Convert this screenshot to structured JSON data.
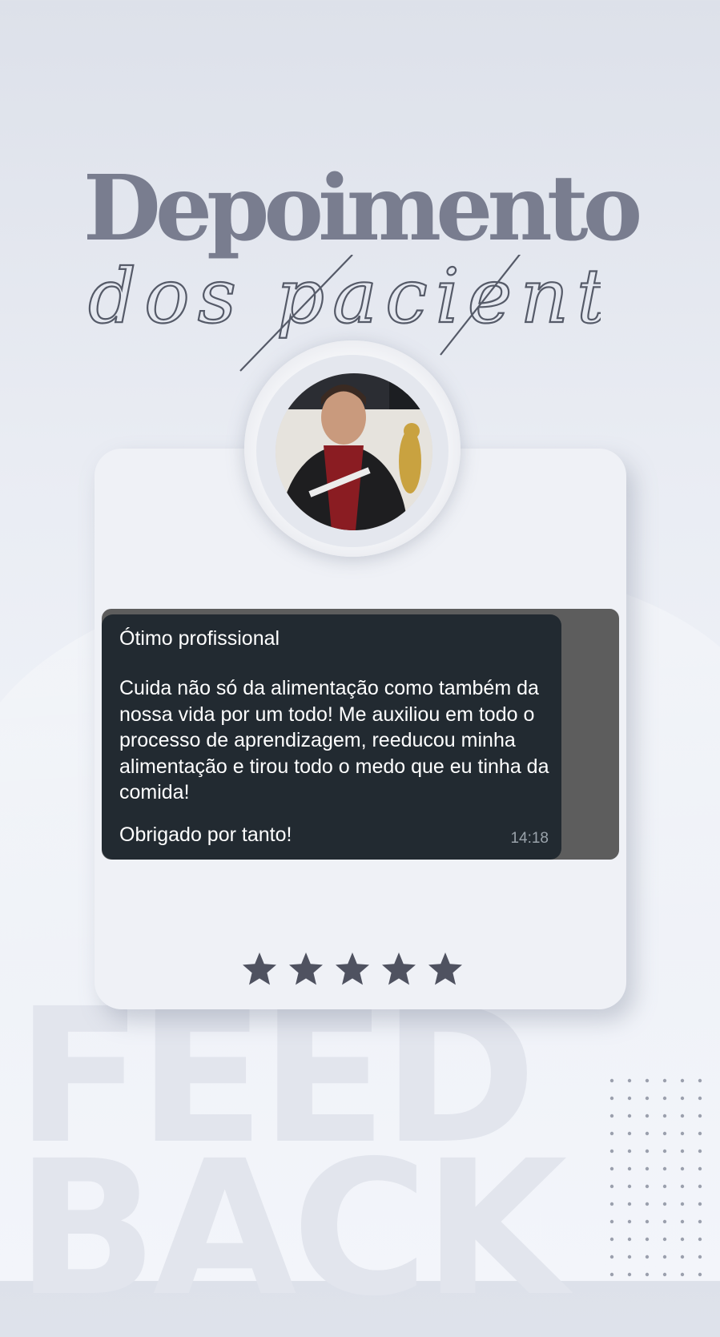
{
  "header": {
    "title": "Depoimento",
    "subtitle": "dos pacientes"
  },
  "profile": {
    "avatar_icon": "person-photo-icon"
  },
  "message": {
    "title": "Ótimo profissional",
    "body": "Cuida não só da alimentação como também da nossa vida por um todo! Me auxiliou em todo o processo de aprendizagem, reeducou minha alimentação e tirou todo o medo que eu tinha da comida!",
    "thanks": "Obrigado por tanto!",
    "time": "14:18"
  },
  "rating": {
    "stars": 5,
    "max": 5,
    "icon": "star-icon",
    "color": "#4f5260"
  },
  "background_text": {
    "line1": "FEED",
    "line2": "BACK"
  },
  "colors": {
    "title": "#797d8f",
    "bubble": "#222a31",
    "bubble_frame": "#5d5d5d"
  }
}
